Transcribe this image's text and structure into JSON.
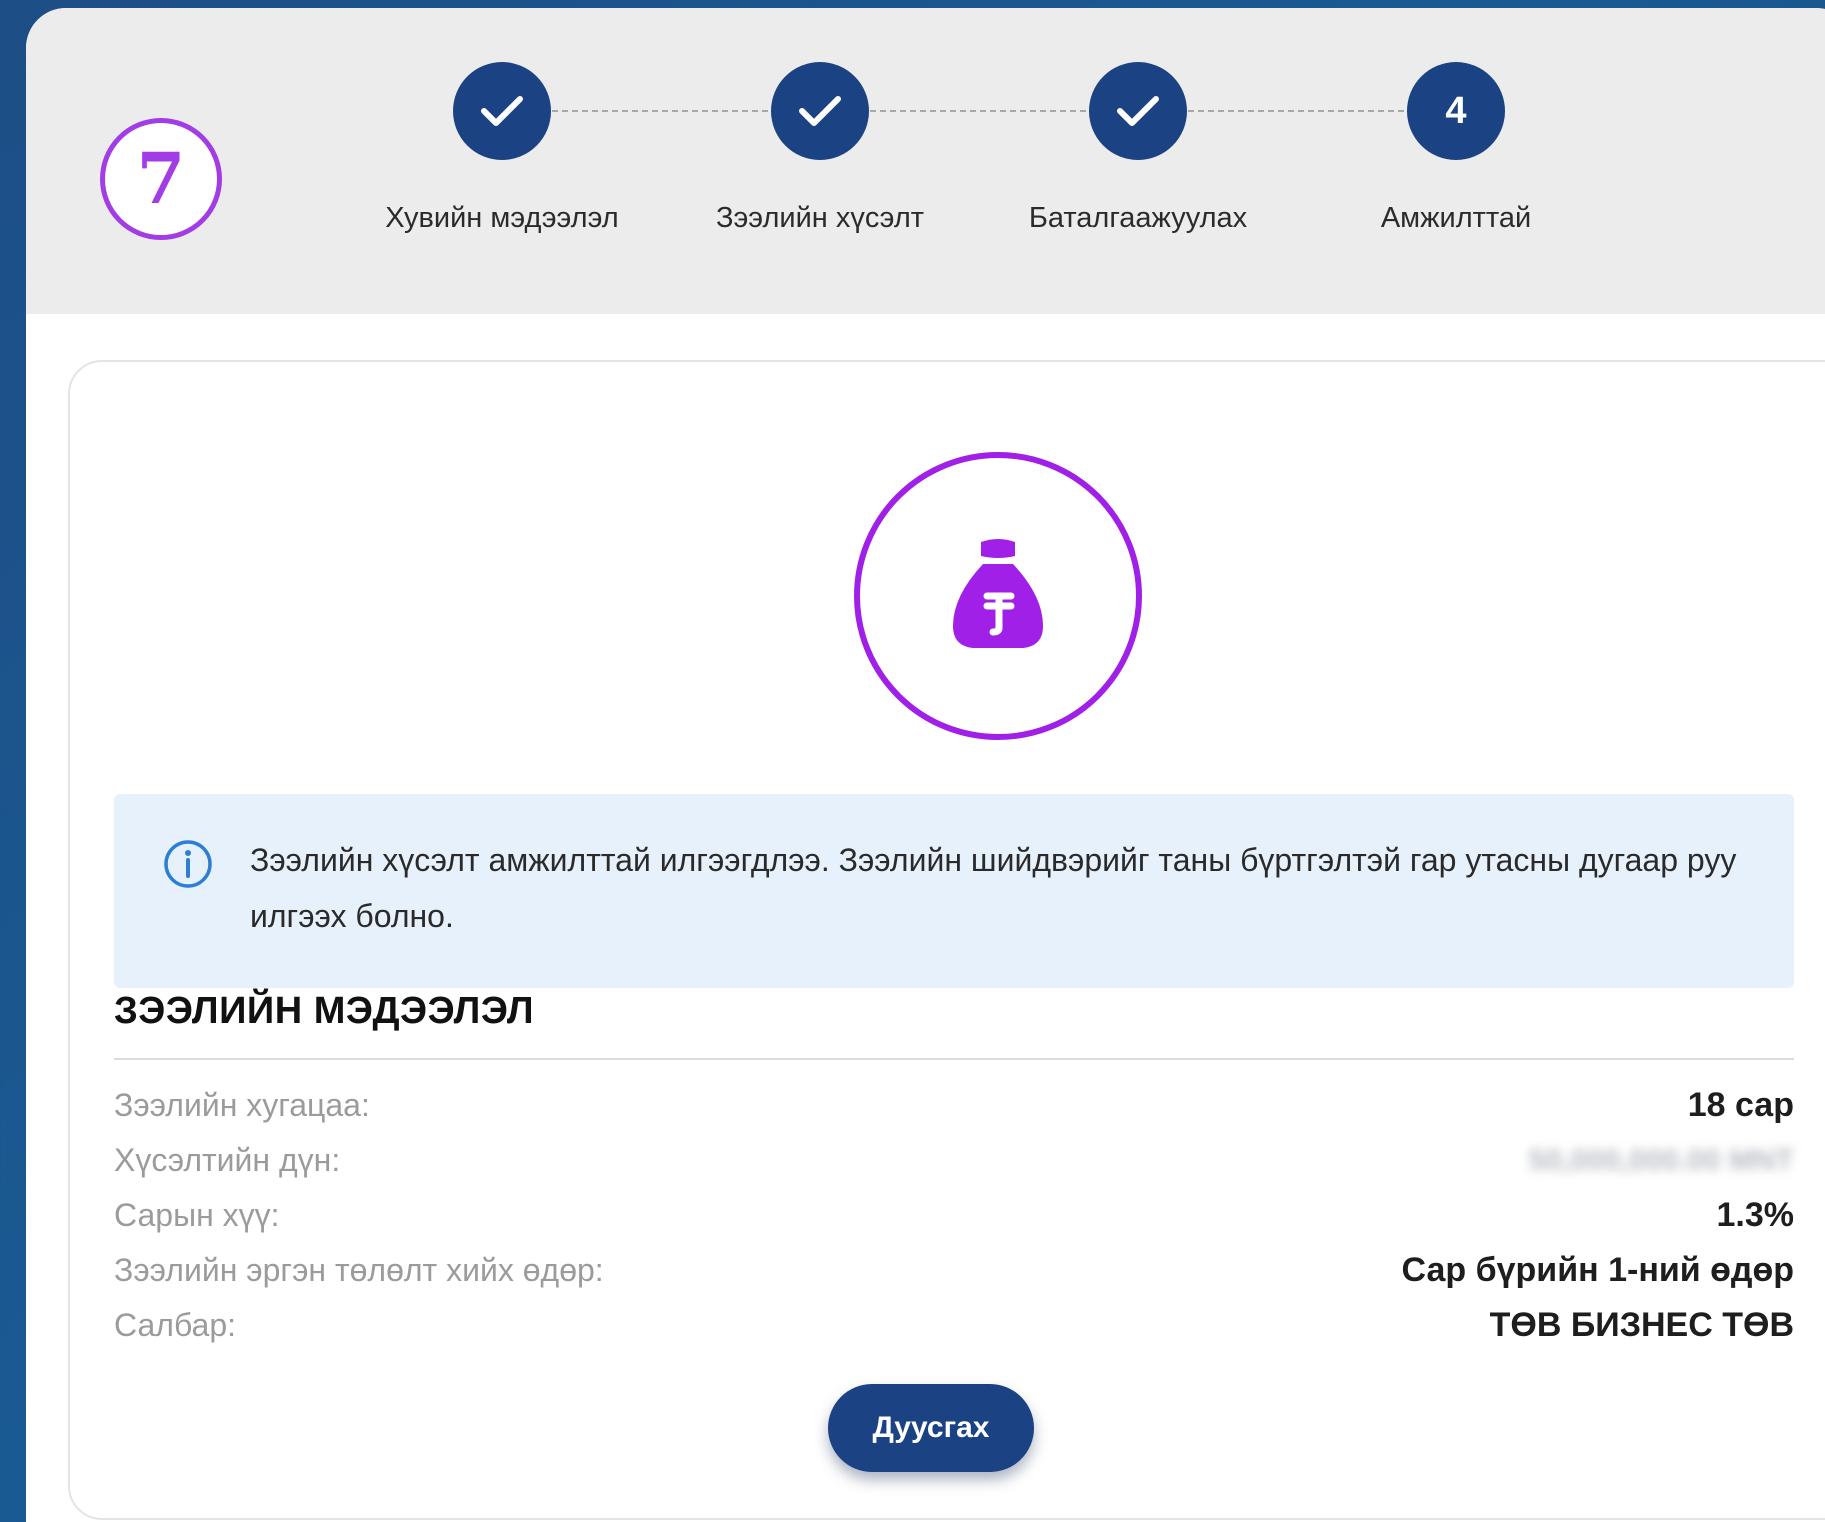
{
  "badge": {
    "number": "7"
  },
  "steps": [
    {
      "label": "Хувийн мэдээлэл",
      "state": "done",
      "marker": ""
    },
    {
      "label": "Зээлийн хүсэлт",
      "state": "done",
      "marker": ""
    },
    {
      "label": "Баталгаажуулах",
      "state": "done",
      "marker": ""
    },
    {
      "label": "Амжилттай",
      "state": "current",
      "marker": "4"
    }
  ],
  "notice": {
    "icon": "info-icon",
    "text": "Зээлийн хүсэлт амжилттай илгээгдлээ. Зээлийн шийдвэрийг таны бүртгэлтэй гар утасны дугаар руу илгээх болно."
  },
  "loan_info": {
    "title": "ЗЭЭЛИЙН МЭДЭЭЛЭЛ",
    "rows": [
      {
        "key": "Зээлийн хугацаа:",
        "value": "18 сар"
      },
      {
        "key": "Хүсэлтийн дүн:",
        "value": "50,000,000.00 MNT",
        "blurred": true
      },
      {
        "key": "Сарын хүү:",
        "value": "1.3%"
      },
      {
        "key": "Зээлийн эргэн төлөлт хийх өдөр:",
        "value": "Сар бүрийн 1-ний өдөр"
      },
      {
        "key": "Салбар:",
        "value": "ТӨВ БИЗНЕС ТӨВ"
      }
    ]
  },
  "actions": {
    "finish_label": "Дуусгах"
  },
  "colors": {
    "primary": "#1b4282",
    "accent": "#a020e8",
    "notice_bg": "#e7f1fb"
  }
}
